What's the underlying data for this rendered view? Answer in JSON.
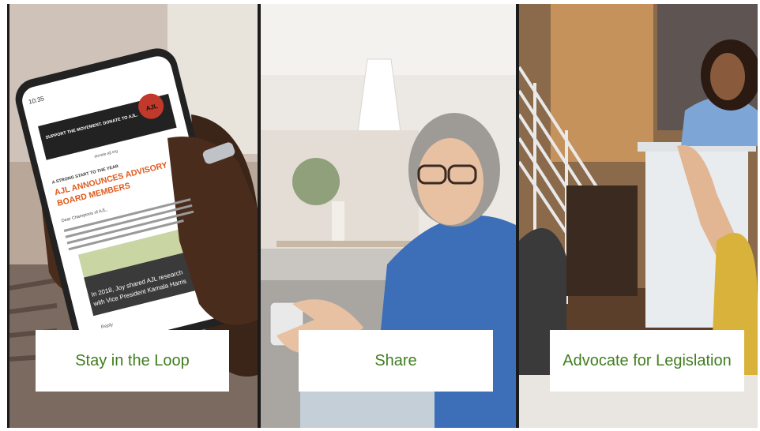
{
  "colors": {
    "accent": "#3f7e1e",
    "email_headline": "#e05a1c",
    "banner": "#222222"
  },
  "panels": [
    {
      "card_label": "Stay in the Loop",
      "phone": {
        "time": "10:35",
        "banner_text": "SUPPORT THE MOVEMENT. DONATE TO AJL.",
        "banner_url": "donate.ajl.org",
        "logo": "AJL",
        "kicker": "A STRONG START TO THE YEAR",
        "headline_1": "AJL ANNOUNCES ADVISORY",
        "headline_2": "BOARD MEMBERS",
        "greeting": "Dear Champions of AJL,",
        "caption_1": "In 2018, Joy shared AJL research",
        "caption_2": "with Vice President Kamala Harris",
        "reply": "Reply"
      }
    },
    {
      "card_label": "Share"
    },
    {
      "card_label": "Advocate for Legislation"
    }
  ]
}
